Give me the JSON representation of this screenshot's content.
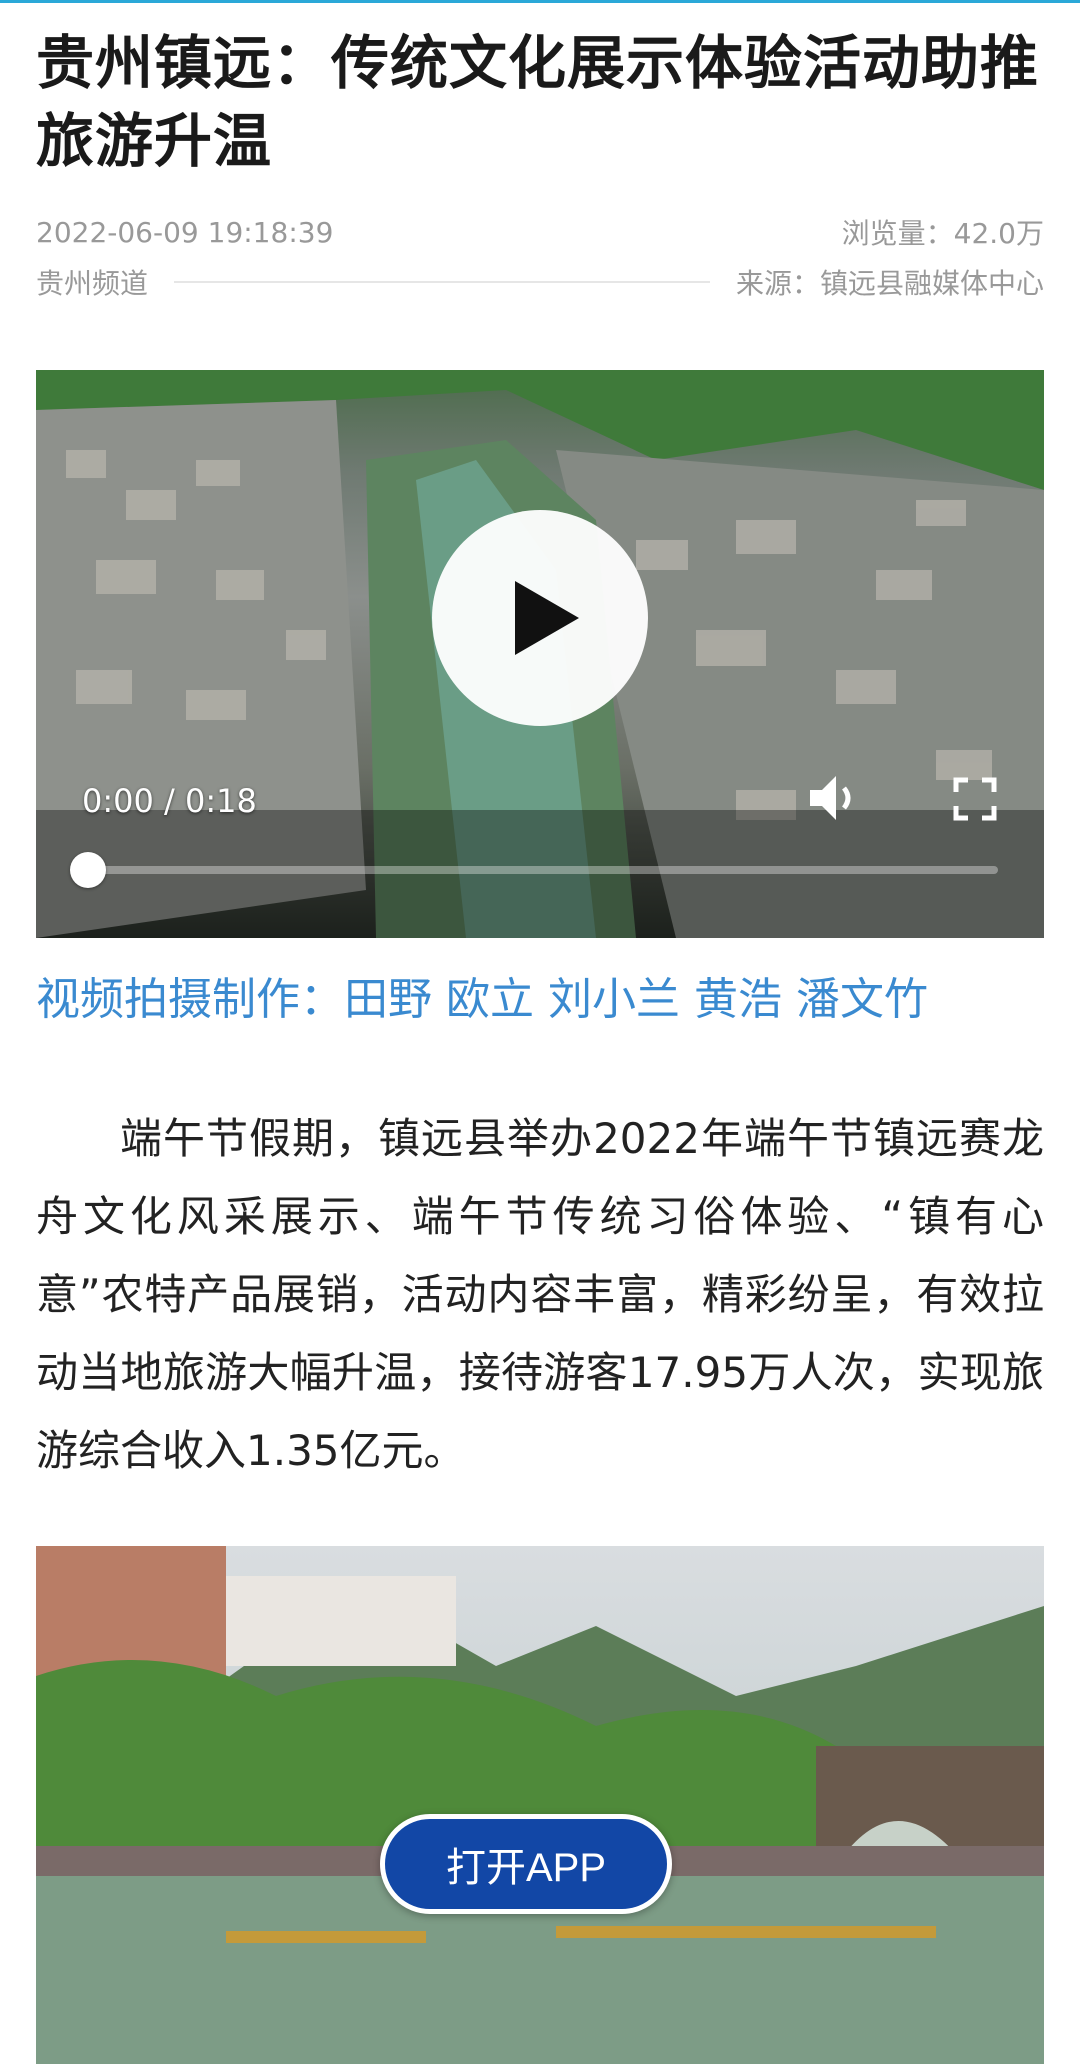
{
  "article": {
    "title": "贵州镇远：传统文化展示体验活动助推旅游升温",
    "published_at": "2022-06-09 19:18:39",
    "views": "浏览量：42.0万",
    "channel": "贵州频道",
    "source": "来源：镇远县融媒体中心",
    "video_credit": "视频拍摄制作：田野 欧立 刘小兰 黄浩 潘文竹",
    "body": "端午节假期，镇远县举办2022年端午节镇远赛龙舟文化风采展示、端午节传统习俗体验、“镇有心意”农特产品展销，活动内容丰富，精彩纷呈，有效拉动当地旅游大幅升温，接待游客17.95万人次，实现旅游综合收入1.35亿元。"
  },
  "video": {
    "time": "0:00 / 0:18",
    "progress": 0,
    "play_icon": "play-icon",
    "volume_icon": "volume-icon",
    "fullscreen_icon": "fullscreen-icon"
  },
  "cta": {
    "open_app_label": "打开APP"
  },
  "colors": {
    "accent": "#2aa8d8",
    "link_blue": "#3a8ad0",
    "cta_blue": "#1247a6",
    "meta_gray": "#999999"
  }
}
